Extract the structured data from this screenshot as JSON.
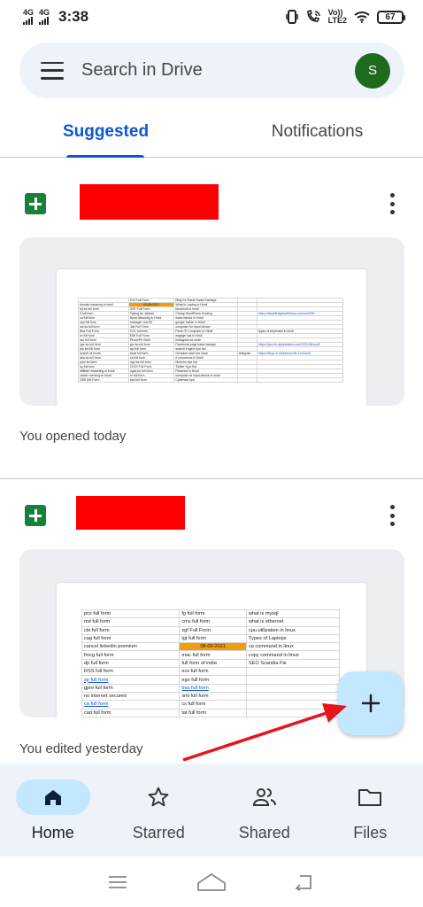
{
  "status_bar": {
    "sim1_gen": "4G",
    "sim2_gen": "4G",
    "time": "3:38",
    "volte": "Vo))",
    "lte": "LTE2",
    "battery": "67"
  },
  "search": {
    "placeholder": "Search in Drive",
    "avatar_initial": "S"
  },
  "tabs": [
    {
      "label": "Suggested",
      "active": true
    },
    {
      "label": "Notifications",
      "active": false
    }
  ],
  "files": [
    {
      "name_redacted": true,
      "meta": "You opened today",
      "preview_rows": [
        [
          "",
          "CSI Full Form",
          "Bing Ke Raste Kaise Kahtega",
          "",
          ""
        ],
        [
          "domain meaning in hindi",
          "09-08-2021",
          "What is Laptop in Hindi",
          "",
          ""
        ],
        [
          "by ka full form",
          "SSF Full Form",
          "facebook in hindi",
          "",
          ""
        ],
        [
          "II full form",
          "Typing ke Jankari",
          "Cheap WordPress Hosting",
          "",
          "https://atozlifestylewellness.com/ca/2009"
        ],
        [
          "ca full form",
          "Sport Meaning in Hindi",
          "www.mentor in hindi",
          "",
          ""
        ],
        [
          "cpa full form",
          "manager and BI",
          "google inside in Hindi",
          "",
          ""
        ],
        [
          "sts ka full form",
          "Jail Full Form",
          "computer for input device",
          "",
          ""
        ],
        [
          "Bba Full Form",
          "CGL full form",
          "Parts Of Computer in Hindi",
          "",
          "types of keyboard in hindi"
        ],
        [
          "cc full form",
          "EMI Full Form",
          "engage sas in hindi",
          "",
          ""
        ],
        [
          "ssc full form",
          "PhonePe Scrie",
          "instagram se node",
          "",
          ""
        ],
        [
          "ojsr ka full form",
          "gm ka full form",
          "Facebook page kaise banaye",
          "",
          "https://ga.ncb.aptiparktea.com/2021/06/a.pdf"
        ],
        [
          "pto ka full form",
          "api full form",
          "search engine kya hai",
          "",
          ""
        ],
        [
          "search ai mode",
          "swat full form",
          "Gif kaise save kre hindi",
          "telegram",
          "https://shop.ni.ca/samsomill-1-in/hindi"
        ],
        [
          "aka ka full form",
          "ca full form",
          "e commerce in hindi",
          "",
          ""
        ],
        [
          "pam ka form",
          "ngo ka full form",
          "Meesho kya hai",
          "",
          ""
        ],
        [
          "sp full form",
          "CHOI Full Form",
          "Twitter Kya Hai",
          "",
          ""
        ],
        [
          "affiliate marketing in hindi",
          "ugas ka full form",
          "Pinterest in Hindi",
          "",
          ""
        ],
        [
          "carrier memory in hindi",
          "ro full form",
          "computer ra input device in hindi",
          "",
          ""
        ],
        [
          "CBS MA Form",
          "ssd full form",
          "Cyberwar kya",
          "",
          ""
        ]
      ]
    },
    {
      "name_redacted": true,
      "meta": "You edited yesterday",
      "preview_rows": [
        [
          "pcs full form",
          "fg full form",
          "what is mysql"
        ],
        [
          "md full form",
          "cms full form",
          "what is ethernet"
        ],
        [
          "cbi full form",
          "zgf Full Form",
          "cpu utilization in linux"
        ],
        [
          "cag full form",
          "tgt full form",
          "Types of Laptops"
        ],
        [
          "cancel linkedin premium",
          "08-09-2021",
          "cp command in linux"
        ],
        [
          "fmcg full form",
          "mac full form",
          "copy command in linux"
        ],
        [
          "dp full form",
          "full form of india",
          "SEO Scandia Fie"
        ],
        [
          "RSS full form",
          "ecs full form",
          ""
        ],
        [
          "sp full form",
          "ego full form",
          ""
        ],
        [
          "gpre full form",
          "bsa full form",
          ""
        ],
        [
          "no internet secured",
          "xml full form",
          ""
        ],
        [
          "ca full form",
          "cs full form",
          ""
        ],
        [
          "cad full form",
          "tat full form",
          ""
        ]
      ]
    }
  ],
  "fab": {
    "icon": "plus-icon"
  },
  "bottom_nav": [
    {
      "label": "Home",
      "icon": "home-icon",
      "active": true
    },
    {
      "label": "Starred",
      "icon": "star-icon",
      "active": false
    },
    {
      "label": "Shared",
      "icon": "shared-icon",
      "active": false
    },
    {
      "label": "Files",
      "icon": "folder-icon",
      "active": false
    }
  ],
  "colors": {
    "accent": "#0b57d0",
    "sheets_green": "#188038",
    "avatar_green": "#1e6b1e",
    "redaction": "#ff0000",
    "fab_bg": "#c2e7ff",
    "nav_bg": "#eef2f9",
    "cell_highlight": "#f29c12",
    "annotation_arrow": "#e8141c"
  }
}
